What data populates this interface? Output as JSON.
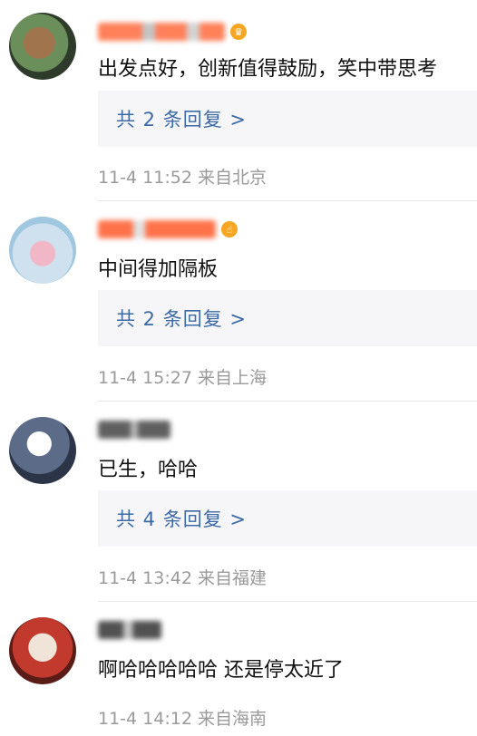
{
  "comments": [
    {
      "text": "出发点好，创新值得鼓励，笑中带思考",
      "replies_label": "共 2 条回复 >",
      "time": "11-4 11:52",
      "location": "来自北京",
      "badge_icon": "crown-icon",
      "name_color": "#ff6a3d"
    },
    {
      "text": "中间得加隔板",
      "replies_label": "共 2 条回复 >",
      "time": "11-4 15:27",
      "location": "来自上海",
      "badge_icon": "hand-icon",
      "name_color": "#ff5a2a"
    },
    {
      "text": "已生，哈哈",
      "replies_label": "共 4 条回复 >",
      "time": "11-4 13:42",
      "location": "来自福建",
      "badge_icon": "",
      "name_color": "#444444"
    },
    {
      "text": "啊哈哈哈哈哈 还是停太近了",
      "replies_label": "",
      "time": "11-4 14:12",
      "location": "来自海南",
      "badge_icon": "",
      "name_color": "#333333"
    }
  ]
}
